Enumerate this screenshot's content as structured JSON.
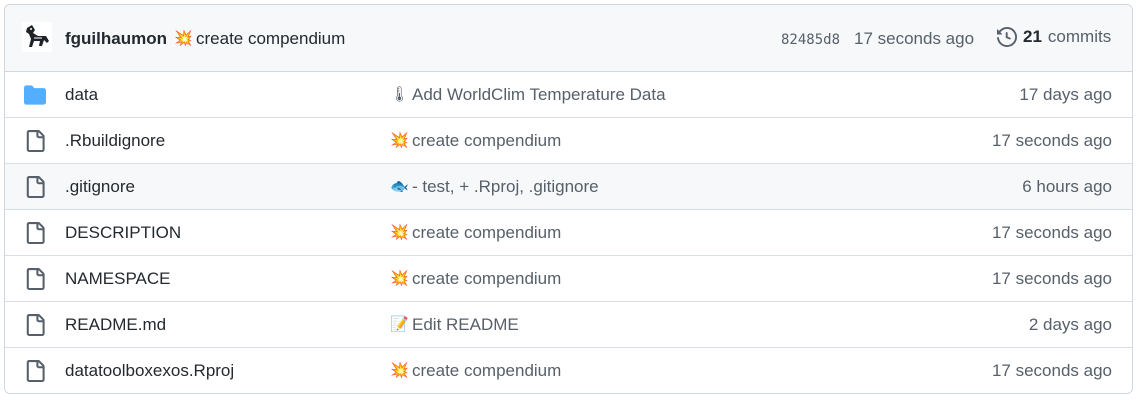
{
  "latest_commit": {
    "author": "fguilhaumon",
    "emoji": "💥",
    "message": "create compendium",
    "sha": "82485d8",
    "time": "17 seconds ago"
  },
  "history": {
    "count": "21",
    "label": "commits",
    "icon": "history-icon"
  },
  "files": [
    {
      "type": "folder",
      "name": "data",
      "emoji": "🌡",
      "message": "Add WorldClim Temperature Data",
      "age": "17 days ago"
    },
    {
      "type": "file",
      "name": ".Rbuildignore",
      "emoji": "💥",
      "message": "create compendium",
      "age": "17 seconds ago"
    },
    {
      "type": "file",
      "name": ".gitignore",
      "emoji": "🐟",
      "message": "- test, + .Rproj, .gitignore",
      "age": "6 hours ago"
    },
    {
      "type": "file",
      "name": "DESCRIPTION",
      "emoji": "💥",
      "message": "create compendium",
      "age": "17 seconds ago"
    },
    {
      "type": "file",
      "name": "NAMESPACE",
      "emoji": "💥",
      "message": "create compendium",
      "age": "17 seconds ago"
    },
    {
      "type": "file",
      "name": "README.md",
      "emoji": "📝",
      "message": "Edit README",
      "age": "2 days ago"
    },
    {
      "type": "file",
      "name": "datatoolboxexos.Rproj",
      "emoji": "💥",
      "message": "create compendium",
      "age": "17 seconds ago"
    }
  ],
  "colors": {
    "folder": "#54aeff",
    "file_icon": "#57606a",
    "border": "#d0d7de",
    "header_bg": "#f6f8fa"
  }
}
